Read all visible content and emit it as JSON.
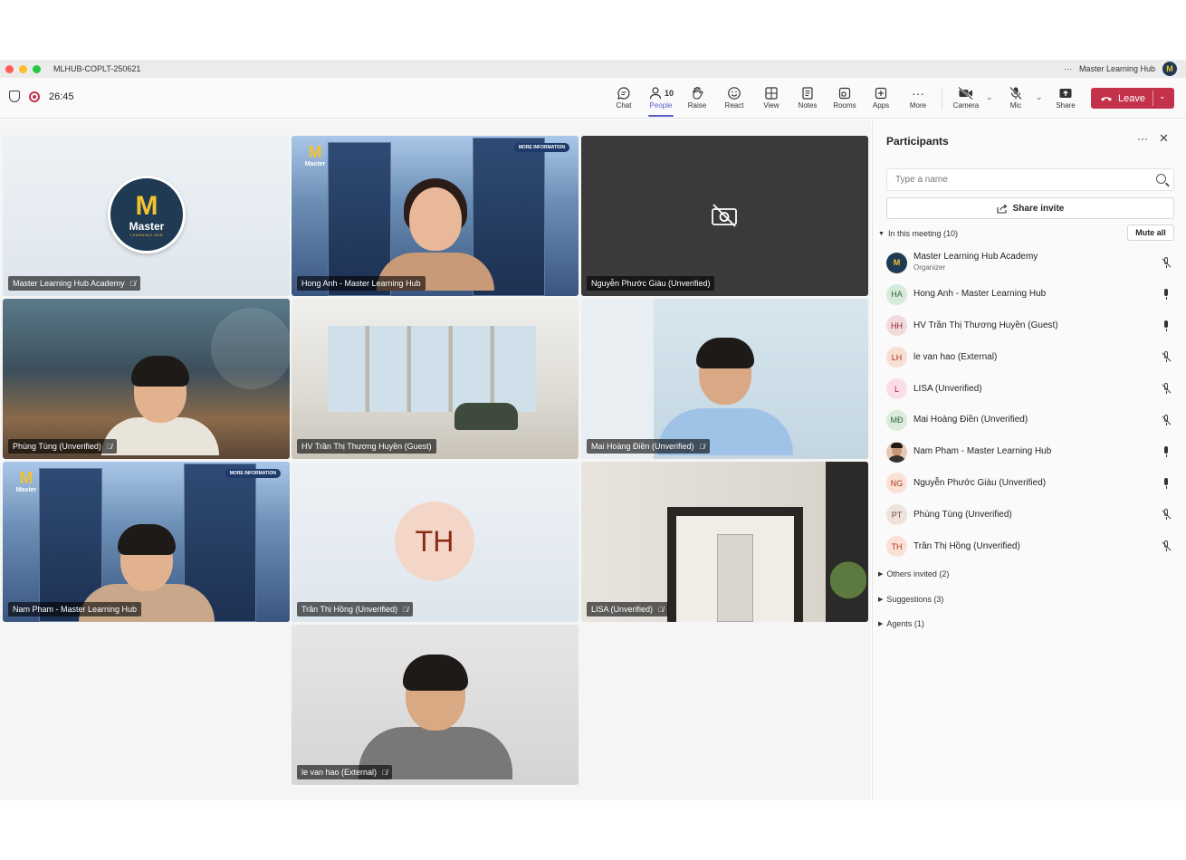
{
  "window": {
    "title": "MLHUB-COPLT-250621",
    "account_name": "Master Learning Hub"
  },
  "meeting": {
    "timer": "26:45"
  },
  "toolbar": {
    "chat": "Chat",
    "people": "People",
    "people_count": "10",
    "raise": "Raise",
    "react": "React",
    "view": "View",
    "notes": "Notes",
    "rooms": "Rooms",
    "apps": "Apps",
    "more": "More",
    "camera": "Camera",
    "mic": "Mic",
    "share": "Share",
    "leave": "Leave"
  },
  "tiles": [
    {
      "name": "Master Learning Hub Academy",
      "logo_letter": "M",
      "logo_text": "Master",
      "logo_sub": "LEARNING HUB"
    },
    {
      "name": "Hong Anh - Master Learning Hub",
      "tag": "MORE INFORMATION"
    },
    {
      "name": "Nguyễn Phước Giàu (Unverified)"
    },
    {
      "name": "Phùng Tùng (Unverified)"
    },
    {
      "name": "HV Trần Thị Thương Huyền (Guest)"
    },
    {
      "name": "Mai Hoàng Điền (Unverified)"
    },
    {
      "name": "Nam Pham - Master Learning Hub",
      "tag": "MORE INFORMATION"
    },
    {
      "name": "Trần Thị Hồng (Unverified)",
      "initials": "TH"
    },
    {
      "name": "LISA (Unverified)"
    },
    {
      "name": "le van hao (External)"
    }
  ],
  "panel": {
    "title": "Participants",
    "search_placeholder": "Type a name",
    "share_invite": "Share invite",
    "in_meeting": "In this meeting (10)",
    "mute_all": "Mute all",
    "others_invited": "Others invited (2)",
    "suggestions": "Suggestions (3)",
    "agents": "Agents (1)",
    "participants": [
      {
        "initials": "M",
        "name": "Master Learning Hub Academy",
        "role": "Organizer",
        "mic": "off"
      },
      {
        "initials": "HA",
        "name": "Hong Anh - Master Learning Hub",
        "mic": "on"
      },
      {
        "initials": "HH",
        "name": "HV Trần Thị Thương Huyền (Guest)",
        "mic": "on"
      },
      {
        "initials": "LH",
        "name": "le van hao (External)",
        "mic": "off"
      },
      {
        "initials": "L",
        "name": "LISA (Unverified)",
        "mic": "off"
      },
      {
        "initials": "MĐ",
        "name": "Mai Hoàng Điền (Unverified)",
        "mic": "off"
      },
      {
        "initials": "",
        "name": "Nam Pham - Master Learning Hub",
        "mic": "on"
      },
      {
        "initials": "NG",
        "name": "Nguyễn Phước Giàu (Unverified)",
        "mic": "on"
      },
      {
        "initials": "PT",
        "name": "Phùng Tùng (Unverified)",
        "mic": "off"
      },
      {
        "initials": "TH",
        "name": "Trần Thị Hồng (Unverified)",
        "mic": "off"
      }
    ]
  },
  "colors": {
    "accent": "#5b5fc7",
    "leave": "#c4314b",
    "brand_navy": "#1f3a52",
    "brand_gold": "#f2c230"
  }
}
